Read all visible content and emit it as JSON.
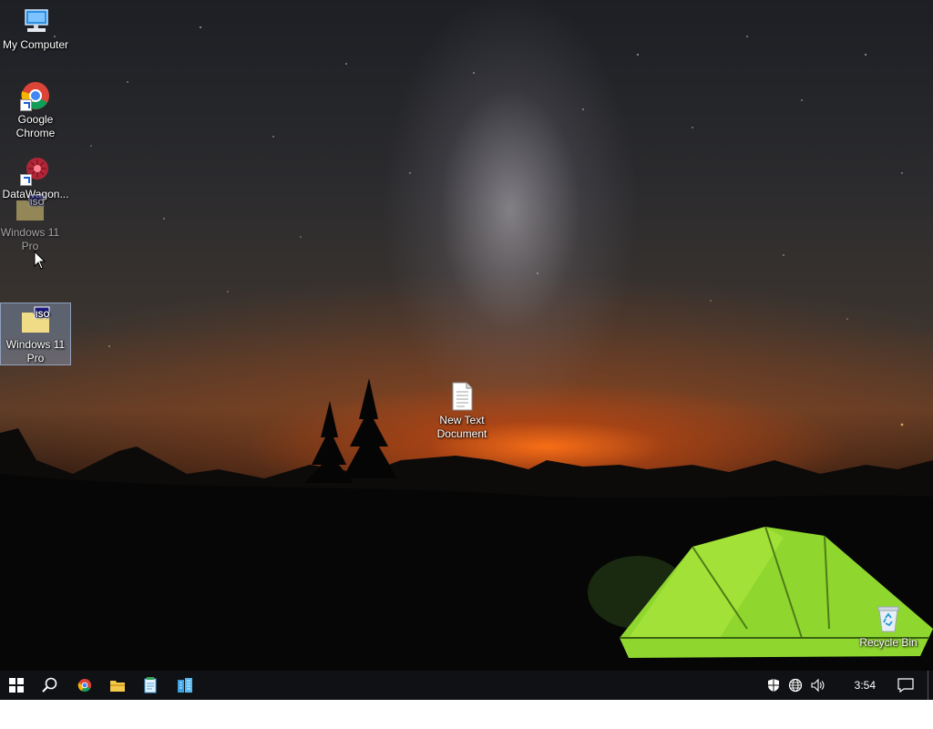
{
  "desktop": {
    "icons": [
      {
        "label": "My Computer",
        "icon": "computer-icon"
      },
      {
        "label": "Google Chrome",
        "icon": "chrome-icon"
      },
      {
        "label": "DataWagon...",
        "icon": "datawagon-icon"
      },
      {
        "label": "Windows 11 Pro",
        "icon": "iso-file-icon"
      },
      {
        "label": "Windows 11 Pro",
        "icon": "iso-file-icon",
        "selected": true
      },
      {
        "label": "New Text Document",
        "icon": "text-document-icon"
      },
      {
        "label": "Recycle Bin",
        "icon": "recycle-bin-icon"
      }
    ],
    "iso_badge": "ISO"
  },
  "taskbar": {
    "items": [
      "start-button",
      "search-button",
      "chrome-taskbar-button",
      "file-explorer-button",
      "notepad-taskbar-button",
      "store-taskbar-button"
    ],
    "tray": [
      "security-icon",
      "network-icon",
      "volume-icon"
    ],
    "clock": "3:54 PM",
    "action_center": "notification-icon"
  }
}
